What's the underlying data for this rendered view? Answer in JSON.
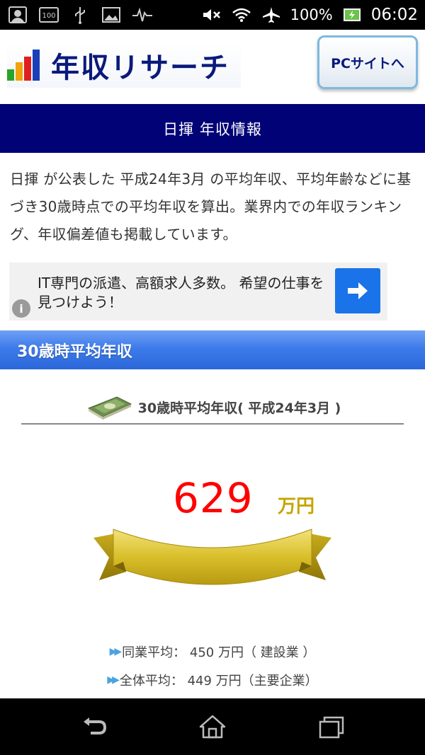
{
  "status_bar": {
    "battery_percent": "100%",
    "time": "06:02",
    "icons": [
      "image-icon",
      "notification-100-icon",
      "usb-icon",
      "picture-icon",
      "pulse-icon",
      "mute-icon",
      "wifi-icon",
      "airplane-icon",
      "battery-charging-icon"
    ]
  },
  "header": {
    "logo_text": "年収リサーチ",
    "pc_site_button": "PCサイトへ"
  },
  "title_band": "日揮 年収情報",
  "description": "日揮 が公表した 平成24年3月 の平均年収、平均年齢などに基づき30歳時点での平均年収を算出。業界内での年収ランキング、年収偏差値も掲載しています。",
  "ad": {
    "text": "IT専門の派遣、高額求人多数。 希望の仕事を見つけよう！",
    "info_icon": "info-icon",
    "arrow_icon": "arrow-right-icon"
  },
  "section": {
    "heading": "30歳時平均年収",
    "subtitle": "30歳時平均年収( 平成24年3月 )",
    "value": "629",
    "unit": "万円",
    "industry_avg": "同業平均： 450 万円（ 建設業 ）",
    "overall_avg": "全体平均： 449 万円（主要企業）"
  },
  "colors": {
    "title_band": "#020277",
    "section_head": "#3d7bea",
    "value_red": "#ff0000",
    "unit_gold": "#c6a400"
  },
  "nav": [
    "back-icon",
    "home-icon",
    "recent-apps-icon"
  ]
}
